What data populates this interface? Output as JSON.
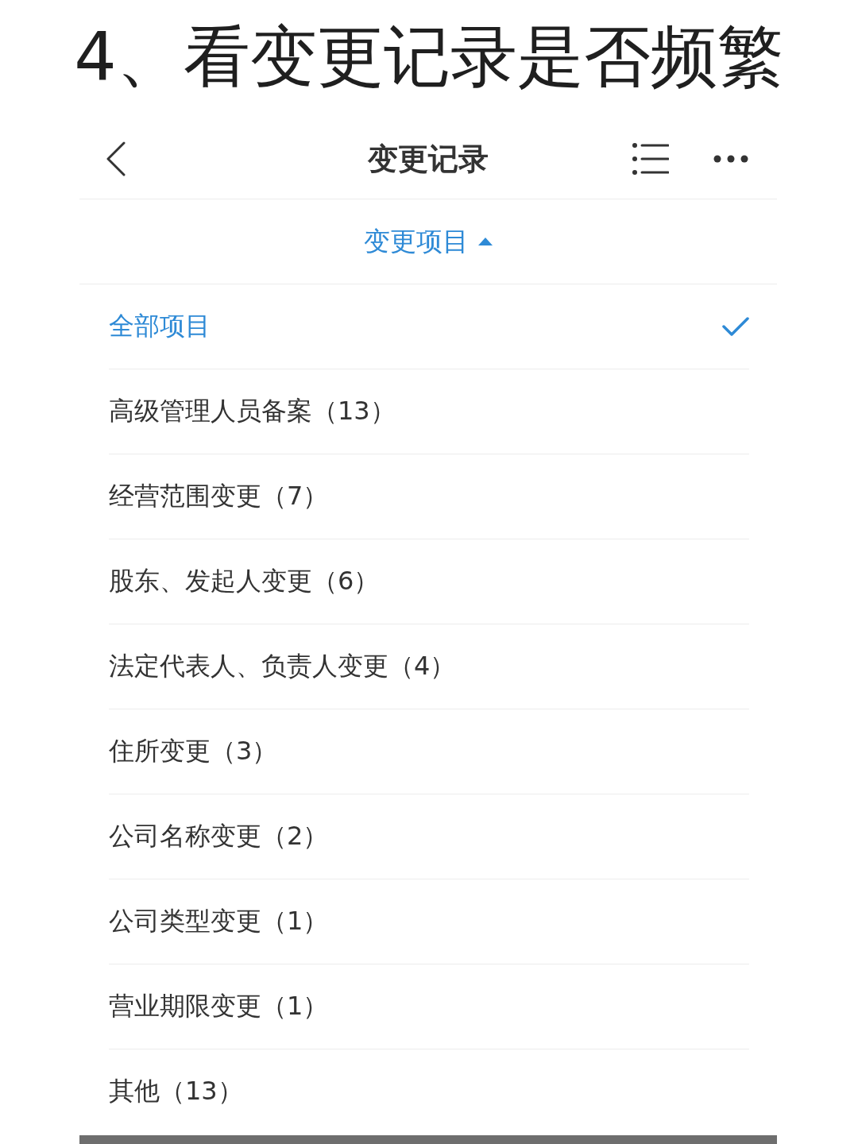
{
  "headline": "4、看变更记录是否频繁",
  "nav": {
    "title": "变更记录"
  },
  "filter": {
    "label": "变更项目",
    "expanded": true
  },
  "options": [
    {
      "label": "全部项目",
      "selected": true
    },
    {
      "label": "高级管理人员备案（13）",
      "selected": false
    },
    {
      "label": "经营范围变更（7）",
      "selected": false
    },
    {
      "label": "股东、发起人变更（6）",
      "selected": false
    },
    {
      "label": "法定代表人、负责人变更（4）",
      "selected": false
    },
    {
      "label": "住所变更（3）",
      "selected": false
    },
    {
      "label": "公司名称变更（2）",
      "selected": false
    },
    {
      "label": "公司类型变更（1）",
      "selected": false
    },
    {
      "label": "营业期限变更（1）",
      "selected": false
    },
    {
      "label": "其他（13）",
      "selected": false
    }
  ]
}
